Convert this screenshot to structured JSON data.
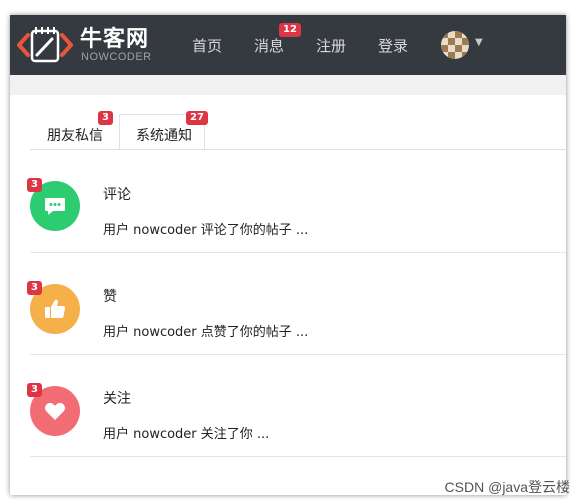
{
  "header": {
    "logo_cn": "牛客网",
    "logo_en": "NOWCODER",
    "nav": [
      {
        "label": "首页"
      },
      {
        "label": "消息",
        "badge": "12"
      },
      {
        "label": "注册"
      },
      {
        "label": "登录"
      }
    ]
  },
  "tabs": [
    {
      "label": "朋友私信",
      "badge": "3",
      "active": false
    },
    {
      "label": "系统通知",
      "badge": "27",
      "active": true
    }
  ],
  "notices": [
    {
      "badge": "3",
      "title": "评论",
      "text": "用户 nowcoder 评论了你的帖子 ...",
      "icon": "comment-icon",
      "color": "#2ecc71"
    },
    {
      "badge": "3",
      "title": "赞",
      "text": "用户 nowcoder 点赞了你的帖子 ...",
      "icon": "thumbs-up-icon",
      "color": "#f5b04a"
    },
    {
      "badge": "3",
      "title": "关注",
      "text": "用户 nowcoder 关注了你 ...",
      "icon": "heart-icon",
      "color": "#f26d73"
    }
  ],
  "watermark": "CSDN @java登云楼",
  "colors": {
    "navbar": "#343a40",
    "badge": "#dc3545"
  }
}
